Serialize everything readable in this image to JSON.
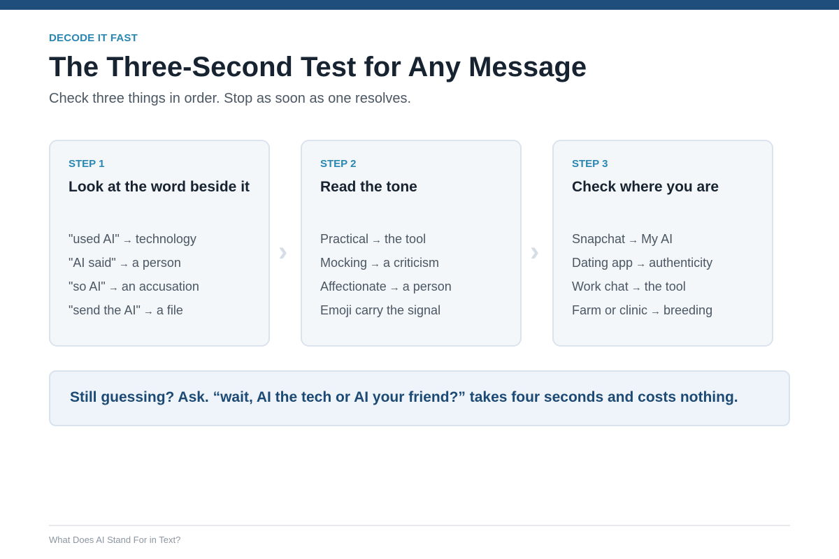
{
  "header": {
    "eyebrow": "DECODE IT FAST",
    "title": "The Three-Second Test for Any Message",
    "subtitle": "Check three things in order. Stop as soon as one resolves."
  },
  "steps": [
    {
      "label": "STEP 1",
      "heading": "Look at the word beside it",
      "items": [
        {
          "left": "\"used AI\"",
          "right": "technology"
        },
        {
          "left": "\"AI said\"",
          "right": "a person"
        },
        {
          "left": "\"so AI\"",
          "right": "an accusation"
        },
        {
          "left": "\"send the AI\"",
          "right": "a file"
        }
      ]
    },
    {
      "label": "STEP 2",
      "heading": "Read the tone",
      "items": [
        {
          "left": "Practical",
          "right": "the tool"
        },
        {
          "left": "Mocking",
          "right": "a criticism"
        },
        {
          "left": "Affectionate",
          "right": "a person"
        },
        {
          "left": "Emoji carry the signal",
          "right": ""
        }
      ]
    },
    {
      "label": "STEP 3",
      "heading": "Check where you are",
      "items": [
        {
          "left": "Snapchat",
          "right": "My AI"
        },
        {
          "left": "Dating app",
          "right": "authenticity"
        },
        {
          "left": "Work chat",
          "right": "the tool"
        },
        {
          "left": "Farm or clinic",
          "right": "breeding"
        }
      ]
    }
  ],
  "arrow_glyph": "→",
  "chevron_glyph": "›",
  "callout": {
    "text": "Still guessing? Ask. “wait, AI the tech or AI your friend?” takes four seconds and costs nothing."
  },
  "footer": {
    "text": "What Does AI Stand For in Text?"
  },
  "colors": {
    "top_bar": "#1f4e7d",
    "accent": "#2a86b2",
    "title": "#172330",
    "callout_text": "#1c4a74"
  }
}
